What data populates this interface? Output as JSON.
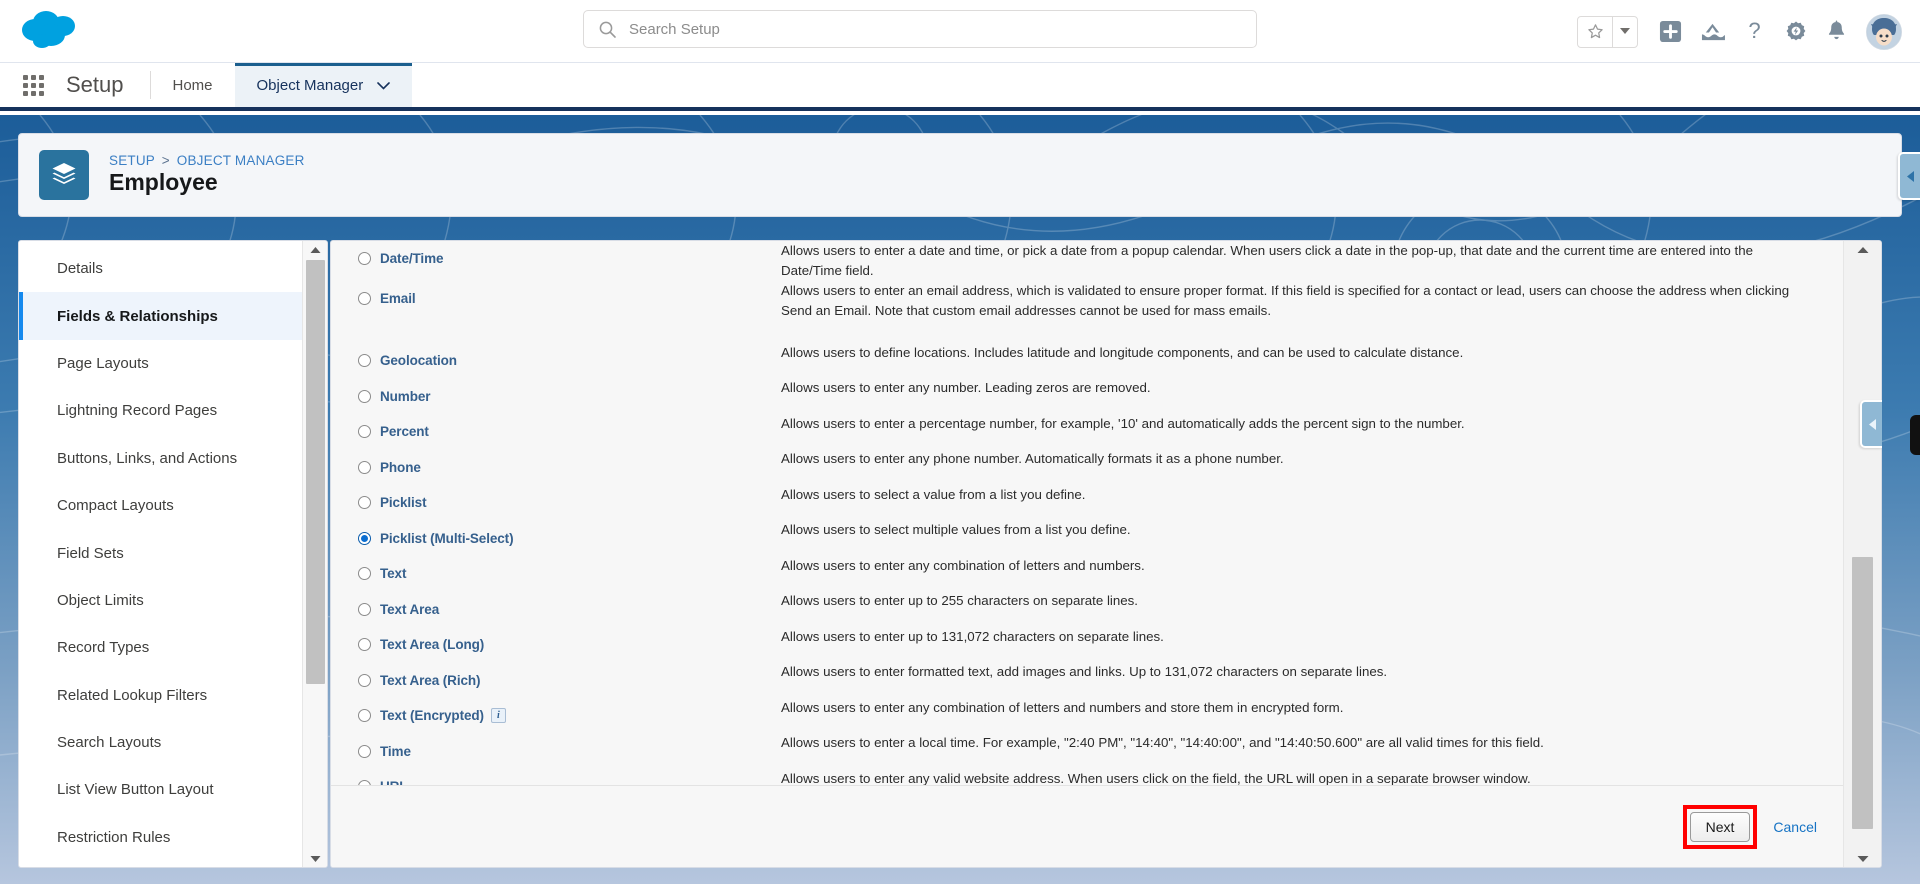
{
  "app": {
    "product": "Salesforce",
    "setup_label": "Setup"
  },
  "search": {
    "placeholder": "Search Setup",
    "value": "",
    "icon": "search-icon"
  },
  "header_icons": [
    {
      "name": "favorites-star-icon",
      "glyph": "star"
    },
    {
      "name": "favorites-dropdown-icon",
      "glyph": "caret-down"
    },
    {
      "name": "add-icon",
      "glyph": "plus-square"
    },
    {
      "name": "trailhead-icon",
      "glyph": "mountain-cloud"
    },
    {
      "name": "help-icon",
      "glyph": "question-mark"
    },
    {
      "name": "setup-gear-icon",
      "glyph": "gear-lightning"
    },
    {
      "name": "notifications-bell-icon",
      "glyph": "bell"
    },
    {
      "name": "user-avatar",
      "glyph": "astro-avatar"
    }
  ],
  "nav_tabs": [
    {
      "label": "Home",
      "active": false,
      "has_caret": false
    },
    {
      "label": "Object Manager",
      "active": true,
      "has_caret": true
    }
  ],
  "page_header": {
    "breadcrumb": [
      "SETUP",
      "OBJECT MANAGER"
    ],
    "breadcrumb_separator": ">",
    "title": "Employee",
    "object_icon": "layers-stack-icon",
    "object_icon_color": "#2a739e"
  },
  "sidebar": {
    "items": [
      {
        "label": "Details",
        "active": false
      },
      {
        "label": "Fields & Relationships",
        "active": true
      },
      {
        "label": "Page Layouts",
        "active": false
      },
      {
        "label": "Lightning Record Pages",
        "active": false
      },
      {
        "label": "Buttons, Links, and Actions",
        "active": false
      },
      {
        "label": "Compact Layouts",
        "active": false
      },
      {
        "label": "Field Sets",
        "active": false
      },
      {
        "label": "Object Limits",
        "active": false
      },
      {
        "label": "Record Types",
        "active": false
      },
      {
        "label": "Related Lookup Filters",
        "active": false
      },
      {
        "label": "Search Layouts",
        "active": false
      },
      {
        "label": "List View Button Layout",
        "active": false
      },
      {
        "label": "Restriction Rules",
        "active": false
      }
    ]
  },
  "field_types": [
    {
      "label": "Date/Time",
      "selected": false,
      "has_info": false,
      "gap_after": false,
      "description": "Allows users to enter a date and time, or pick a date from a popup calendar. When users click a date in the pop-up, that date and the current time are entered into the Date/Time field."
    },
    {
      "label": "Email",
      "selected": false,
      "has_info": false,
      "gap_after": true,
      "description": "Allows users to enter an email address, which is validated to ensure proper format. If this field is specified for a contact or lead, users can choose the address when clicking Send an Email. Note that custom email addresses cannot be used for mass emails."
    },
    {
      "label": "Geolocation",
      "selected": false,
      "has_info": false,
      "gap_after": false,
      "description": "Allows users to define locations. Includes latitude and longitude components, and can be used to calculate distance."
    },
    {
      "label": "Number",
      "selected": false,
      "has_info": false,
      "gap_after": false,
      "description": "Allows users to enter any number. Leading zeros are removed."
    },
    {
      "label": "Percent",
      "selected": false,
      "has_info": false,
      "gap_after": false,
      "description": "Allows users to enter a percentage number, for example, '10' and automatically adds the percent sign to the number."
    },
    {
      "label": "Phone",
      "selected": false,
      "has_info": false,
      "gap_after": false,
      "description": "Allows users to enter any phone number. Automatically formats it as a phone number."
    },
    {
      "label": "Picklist",
      "selected": false,
      "has_info": false,
      "gap_after": false,
      "description": "Allows users to select a value from a list you define."
    },
    {
      "label": "Picklist (Multi-Select)",
      "selected": true,
      "has_info": false,
      "gap_after": false,
      "description": "Allows users to select multiple values from a list you define."
    },
    {
      "label": "Text",
      "selected": false,
      "has_info": false,
      "gap_after": false,
      "description": "Allows users to enter any combination of letters and numbers."
    },
    {
      "label": "Text Area",
      "selected": false,
      "has_info": false,
      "gap_after": false,
      "description": "Allows users to enter up to 255 characters on separate lines."
    },
    {
      "label": "Text Area (Long)",
      "selected": false,
      "has_info": false,
      "gap_after": false,
      "description": "Allows users to enter up to 131,072 characters on separate lines."
    },
    {
      "label": "Text Area (Rich)",
      "selected": false,
      "has_info": false,
      "gap_after": false,
      "description": "Allows users to enter formatted text, add images and links. Up to 131,072 characters on separate lines."
    },
    {
      "label": "Text (Encrypted)",
      "selected": false,
      "has_info": true,
      "info_glyph": "i",
      "gap_after": false,
      "description": "Allows users to enter any combination of letters and numbers and store them in encrypted form."
    },
    {
      "label": "Time",
      "selected": false,
      "has_info": false,
      "gap_after": false,
      "description": "Allows users to enter a local time. For example, \"2:40 PM\", \"14:40\", \"14:40:00\", and \"14:40:50.600\" are all valid times for this field."
    },
    {
      "label": "URL",
      "selected": false,
      "has_info": false,
      "gap_after": false,
      "description": "Allows users to enter any valid website address. When users click on the field, the URL will open in a separate browser window."
    }
  ],
  "footer": {
    "next_label": "Next",
    "cancel_label": "Cancel",
    "highlight_color": "#ff0000"
  },
  "colors": {
    "brand_blue": "#1589ee",
    "header_navy": "#16325c",
    "link_blue": "#1673c4",
    "radio_label_blue": "#36608d",
    "selected_radio": "#0b6ed1",
    "active_sidebar_bg": "#eef4fc"
  }
}
